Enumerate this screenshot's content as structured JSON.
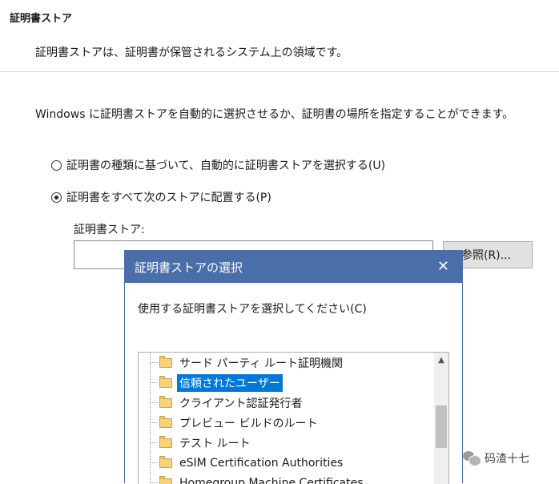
{
  "wizard": {
    "section_title": "証明書ストア",
    "section_subtitle": "証明書ストアは、証明書が保管されるシステム上の領域です。",
    "description": "Windows に証明書ストアを自動的に選択させるか、証明書の場所を指定することができます。",
    "option_auto": "証明書の種類に基づいて、自動的に証明書ストアを選択する(U)",
    "option_manual": "証明書をすべて次のストアに配置する(P)",
    "selected_option": "manual",
    "store_label": "証明書ストア:",
    "store_value": "",
    "browse_label": "参照(R)..."
  },
  "dialog": {
    "title": "証明書ストアの選択",
    "close_glyph": "✕",
    "prompt": "使用する証明書ストアを選択してください(C)",
    "items": [
      {
        "label": "サード パーティ ルート証明機関",
        "selected": false
      },
      {
        "label": "信頼されたユーザー",
        "selected": true
      },
      {
        "label": "クライアント認証発行者",
        "selected": false
      },
      {
        "label": "プレビュー ビルドのルート",
        "selected": false
      },
      {
        "label": "テスト ルート",
        "selected": false
      },
      {
        "label": "eSIM Certification Authorities",
        "selected": false
      },
      {
        "label": "Homegroup Machine Certificates",
        "selected": false
      }
    ],
    "scroll_up_glyph": "▲"
  },
  "watermark": {
    "text": "码渣十七"
  },
  "colors": {
    "dialog_titlebar": "#4a6ea8",
    "selection": "#0078d7",
    "folder": "#f4d37a"
  }
}
